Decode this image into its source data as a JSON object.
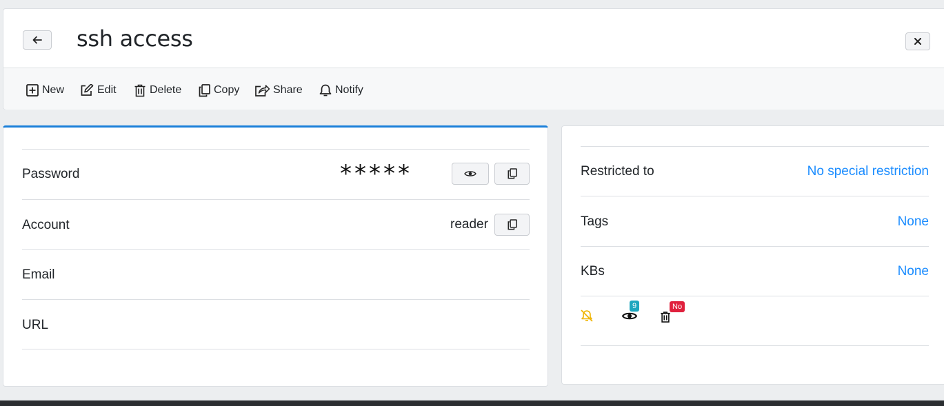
{
  "header": {
    "title": "ssh access"
  },
  "toolbar": {
    "new_label": "New",
    "edit_label": "Edit",
    "delete_label": "Delete",
    "copy_label": "Copy",
    "share_label": "Share",
    "notify_label": "Notify"
  },
  "fields": {
    "password_label": "Password",
    "password_mask": "*****",
    "account_label": "Account",
    "account_value": "reader",
    "email_label": "Email",
    "url_label": "URL"
  },
  "meta": {
    "restricted_label": "Restricted to",
    "restricted_value": "No special restriction",
    "tags_label": "Tags",
    "tags_value": "None",
    "kbs_label": "KBs",
    "kbs_value": "None",
    "views_count": "9",
    "deleted_badge": "No"
  },
  "colors": {
    "accent": "#1a7fd9",
    "link": "#1a8cff",
    "badge_views": "#1ea7bf",
    "badge_deleted": "#e0213d",
    "notify_off": "#f0b400"
  }
}
